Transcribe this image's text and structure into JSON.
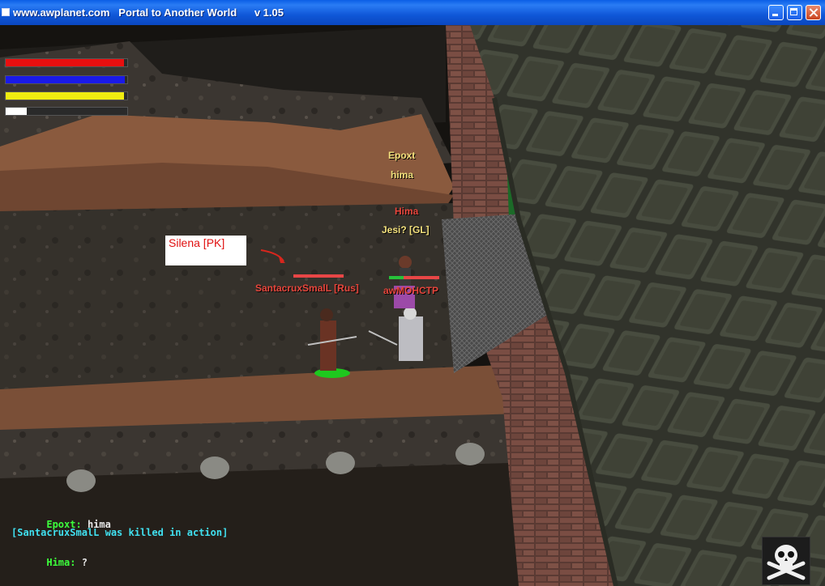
{
  "window": {
    "title": "www.awplanet.com   Portal to Another World      v 1.05"
  },
  "hud": {
    "bars": [
      {
        "name": "health",
        "color": "#e80f0f",
        "level": 0.97
      },
      {
        "name": "mana",
        "color": "#1a1ae8",
        "level": 0.98
      },
      {
        "name": "stamina",
        "color": "#f0ec10",
        "level": 0.97
      },
      {
        "name": "experience",
        "color": "#ffffff",
        "level": 0.17
      }
    ]
  },
  "labels": {
    "epoxt_name": "Epoxt",
    "epoxt_msg": "hima",
    "hima_name": "Hima",
    "jesi_name": "Jesi? [GL]",
    "silena_name": "Silena [PK]",
    "santacrux_name": "SantacruxSmalL [Rus]",
    "awmohctp_name": "awMOHCTP"
  },
  "chat": {
    "line1_name": "Epoxt:",
    "line1_msg": "hima",
    "line2": "[SantacruxSmalL was killed in action]",
    "line3_name": "Hima:",
    "line3_msg": "?"
  },
  "icons": {
    "pk_indicator": "skull-crossbones-icon"
  }
}
